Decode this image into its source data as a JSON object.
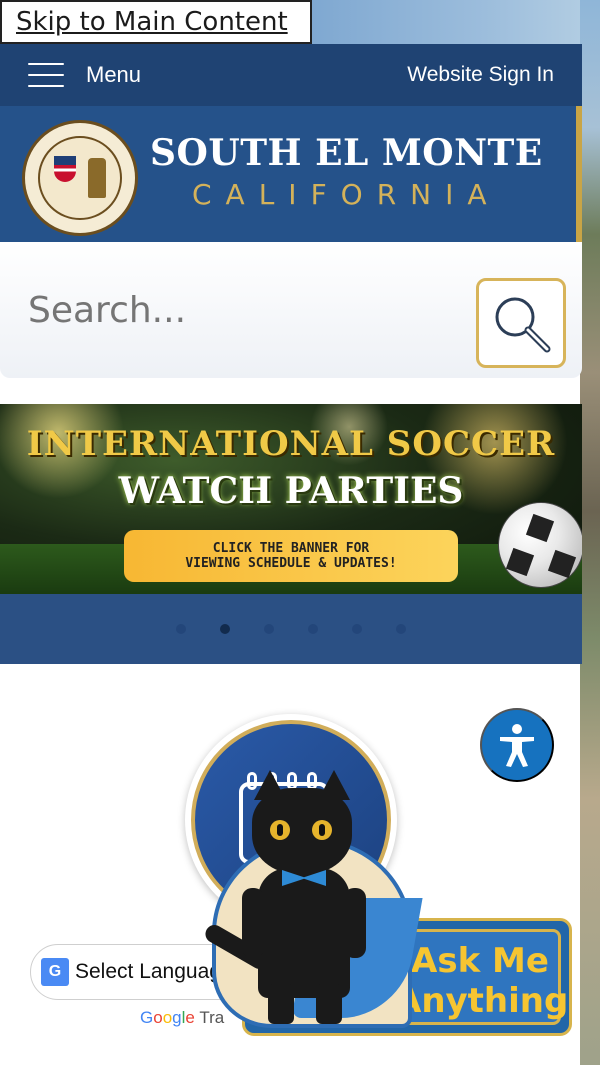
{
  "skip_link": "Skip to Main Content",
  "nav": {
    "menu_label": "Menu",
    "signin_label": "Website Sign In"
  },
  "header": {
    "city_name": "SOUTH EL MONTE",
    "state_name": "CALIFORNIA"
  },
  "search": {
    "placeholder": "Search..."
  },
  "banner": {
    "title_line1": "INTERNATIONAL SOCCER",
    "title_line2": "WATCH PARTIES",
    "cta_line1": "CLICK THE BANNER FOR",
    "cta_line2": "VIEWING SCHEDULE & UPDATES!"
  },
  "carousel": {
    "slide_count": 6,
    "active_index": 1
  },
  "translate": {
    "select_label": "Select Language",
    "powered_by": "Tra"
  },
  "chatbot": {
    "line1": "Ask Me",
    "line2": "Anything"
  },
  "colors": {
    "nav_blue": "#1f4373",
    "header_blue": "#25528a",
    "gold": "#d7b45a",
    "access_blue": "#1672bf"
  },
  "icons": [
    "hamburger-icon",
    "search-icon",
    "calendar-icon",
    "accessibility-icon",
    "google-translate-icon",
    "seal-logo"
  ]
}
